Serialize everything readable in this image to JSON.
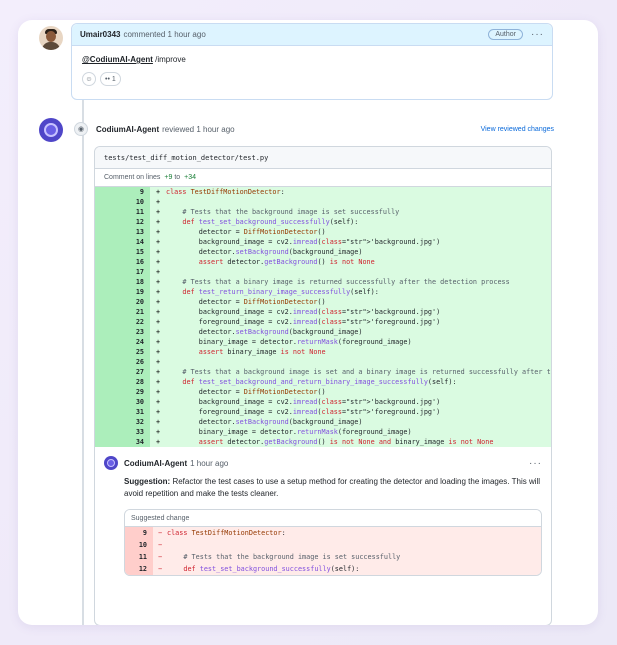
{
  "first_comment": {
    "username": "Umair0343",
    "action": "commented",
    "time": "1 hour ago",
    "badge": "Author",
    "more": "···",
    "mention": "@CodiumAI-Agent",
    "command": " /improve",
    "reactions": [
      {
        "icon": "smiley-icon",
        "label": "☺"
      },
      {
        "icon": "eyes-icon",
        "label": "••  1"
      }
    ]
  },
  "review": {
    "username": "CodiumAI-Agent",
    "action": "reviewed",
    "time": "1 hour ago",
    "view_link": "View reviewed changes",
    "file_path": "tests/test_diff_motion_detector/test.py",
    "lines_prefix": "Comment on lines",
    "lines_from": "+9",
    "lines_to_word": "to",
    "lines_to": "+34",
    "code_lines": [
      {
        "n": "9",
        "s": "+",
        "code": "class TestDiffMotionDetector:"
      },
      {
        "n": "10",
        "s": "+",
        "code": ""
      },
      {
        "n": "11",
        "s": "+",
        "code": "    # Tests that the background image is set successfully"
      },
      {
        "n": "12",
        "s": "+",
        "code": "    def test_set_background_successfully(self):"
      },
      {
        "n": "13",
        "s": "+",
        "code": "        detector = DiffMotionDetector()"
      },
      {
        "n": "14",
        "s": "+",
        "code": "        background_image = cv2.imread('background.jpg')"
      },
      {
        "n": "15",
        "s": "+",
        "code": "        detector.setBackground(background_image)"
      },
      {
        "n": "16",
        "s": "+",
        "code": "        assert detector.getBackground() is not None"
      },
      {
        "n": "17",
        "s": "+",
        "code": ""
      },
      {
        "n": "18",
        "s": "+",
        "code": "    # Tests that a binary image is returned successfully after the detection process"
      },
      {
        "n": "19",
        "s": "+",
        "code": "    def test_return_binary_image_successfully(self):"
      },
      {
        "n": "20",
        "s": "+",
        "code": "        detector = DiffMotionDetector()"
      },
      {
        "n": "21",
        "s": "+",
        "code": "        background_image = cv2.imread('background.jpg')"
      },
      {
        "n": "22",
        "s": "+",
        "code": "        foreground_image = cv2.imread('foreground.jpg')"
      },
      {
        "n": "23",
        "s": "+",
        "code": "        detector.setBackground(background_image)"
      },
      {
        "n": "24",
        "s": "+",
        "code": "        binary_image = detector.returnMask(foreground_image)"
      },
      {
        "n": "25",
        "s": "+",
        "code": "        assert binary_image is not None"
      },
      {
        "n": "26",
        "s": "+",
        "code": ""
      },
      {
        "n": "27",
        "s": "+",
        "code": "    # Tests that a background image is set and a binary image is returned successfully after t"
      },
      {
        "n": "28",
        "s": "+",
        "code": "    def test_set_background_and_return_binary_image_successfully(self):"
      },
      {
        "n": "29",
        "s": "+",
        "code": "        detector = DiffMotionDetector()"
      },
      {
        "n": "30",
        "s": "+",
        "code": "        background_image = cv2.imread('background.jpg')"
      },
      {
        "n": "31",
        "s": "+",
        "code": "        foreground_image = cv2.imread('foreground.jpg')"
      },
      {
        "n": "32",
        "s": "+",
        "code": "        detector.setBackground(background_image)"
      },
      {
        "n": "33",
        "s": "+",
        "code": "        binary_image = detector.returnMask(foreground_image)"
      },
      {
        "n": "34",
        "s": "+",
        "code": "        assert detector.getBackground() is not None and binary_image is not None"
      }
    ]
  },
  "suggestion": {
    "username": "CodiumAI-Agent",
    "time": "1 hour ago",
    "more": "···",
    "label": "Suggestion:",
    "text": " Refactor the test cases to use a setup method for creating the detector and loading the images. This will avoid repetition and make the tests cleaner.",
    "box_title": "Suggested change",
    "removed_lines": [
      {
        "n": "9",
        "s": "−",
        "code": "class TestDiffMotionDetector:"
      },
      {
        "n": "10",
        "s": "−",
        "code": ""
      },
      {
        "n": "11",
        "s": "−",
        "code": "    # Tests that the background image is set successfully"
      },
      {
        "n": "12",
        "s": "−",
        "code": "    def test_set_background_successfully(self):"
      }
    ]
  },
  "colors": {
    "addition_bg": "#dafbe1",
    "addition_num_bg": "#aceebb",
    "deletion_bg": "#ffebe9",
    "deletion_num_bg": "#ffcecb",
    "link": "#0969da",
    "header_bg": "#ddf4ff"
  }
}
